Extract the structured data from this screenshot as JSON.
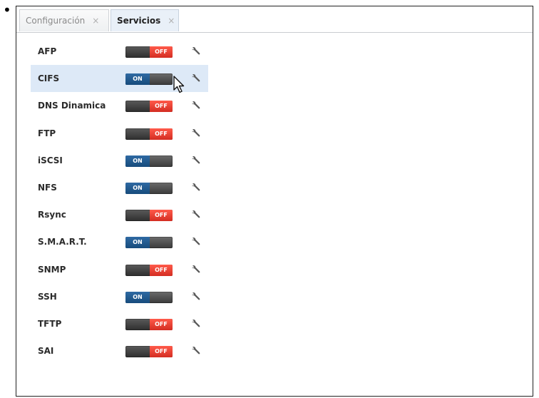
{
  "tabs": [
    {
      "label": "Configuración",
      "close": "×"
    },
    {
      "label": "Servicios",
      "close": "×"
    }
  ],
  "services": [
    {
      "name": "AFP",
      "state": "OFF",
      "enabled": false
    },
    {
      "name": "CIFS",
      "state": "ON",
      "enabled": true,
      "selected": true
    },
    {
      "name": "DNS Dinamica",
      "state": "OFF",
      "enabled": false
    },
    {
      "name": "FTP",
      "state": "OFF",
      "enabled": false
    },
    {
      "name": "iSCSI",
      "state": "ON",
      "enabled": true
    },
    {
      "name": "NFS",
      "state": "ON",
      "enabled": true
    },
    {
      "name": "Rsync",
      "state": "OFF",
      "enabled": false
    },
    {
      "name": "S.M.A.R.T.",
      "state": "ON",
      "enabled": true
    },
    {
      "name": "SNMP",
      "state": "OFF",
      "enabled": false
    },
    {
      "name": "SSH",
      "state": "ON",
      "enabled": true
    },
    {
      "name": "TFTP",
      "state": "OFF",
      "enabled": false
    },
    {
      "name": "SAI",
      "state": "OFF",
      "enabled": false
    }
  ],
  "colors": {
    "off": "#e0342a",
    "on": "#1f5a92",
    "selected_row": "#dde9f7"
  },
  "icons": {
    "settings": "wrench-icon",
    "pointer": "mouse-cursor-icon"
  }
}
